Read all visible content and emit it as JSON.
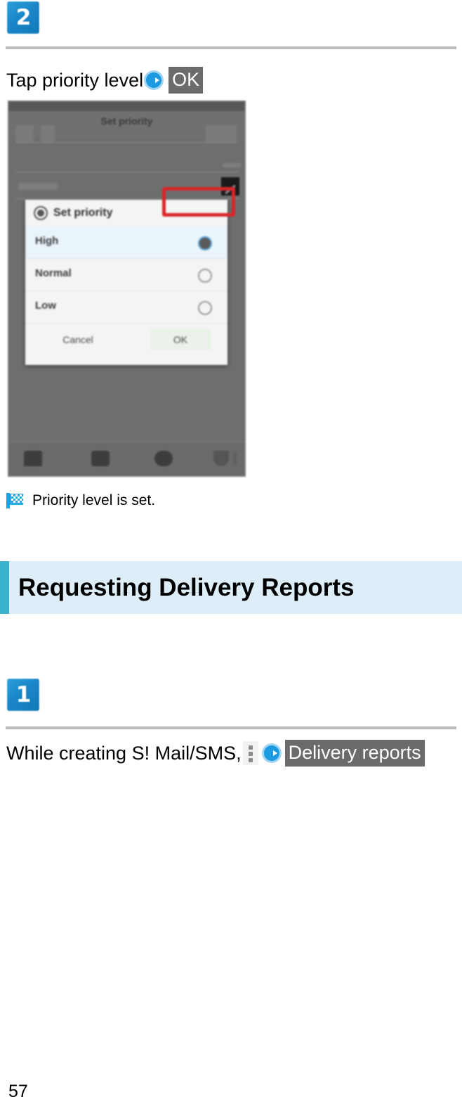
{
  "page": {
    "number": "57"
  },
  "steps": [
    {
      "badge": "2",
      "instruction_prefix": "Tap priority level",
      "arrow_icon": "blue-circle-arrow-icon",
      "chip": "OK"
    },
    {
      "badge": "1",
      "instruction_prefix": "While creating S! Mail/SMS, ",
      "menu_icon": "vertical-three-dots-icon",
      "arrow_icon": "blue-circle-arrow-icon",
      "chip": "Delivery reports"
    }
  ],
  "screenshot": {
    "alt_name": "set-priority-dialog-screenshot",
    "title_bar": "Set priority",
    "dialog": {
      "title": "Set priority",
      "gear_icon": "gear-icon",
      "options": [
        {
          "label": "High",
          "selected": true
        },
        {
          "label": "Normal",
          "selected": false
        },
        {
          "label": "Low",
          "selected": false
        }
      ],
      "cancel_label": "Cancel",
      "ok_label": "OK",
      "highlight_color": "#d9252a"
    },
    "nav_icons": [
      "home-icon",
      "message-icon",
      "contacts-icon",
      "smiley-icon",
      "more-icon"
    ]
  },
  "result": {
    "flag_icon": "checkered-flag-icon",
    "text": "Priority level is set."
  },
  "section": {
    "title": "Requesting Delivery Reports",
    "accent_color": "#3bb3cc",
    "background_color": "#ddeef8"
  }
}
